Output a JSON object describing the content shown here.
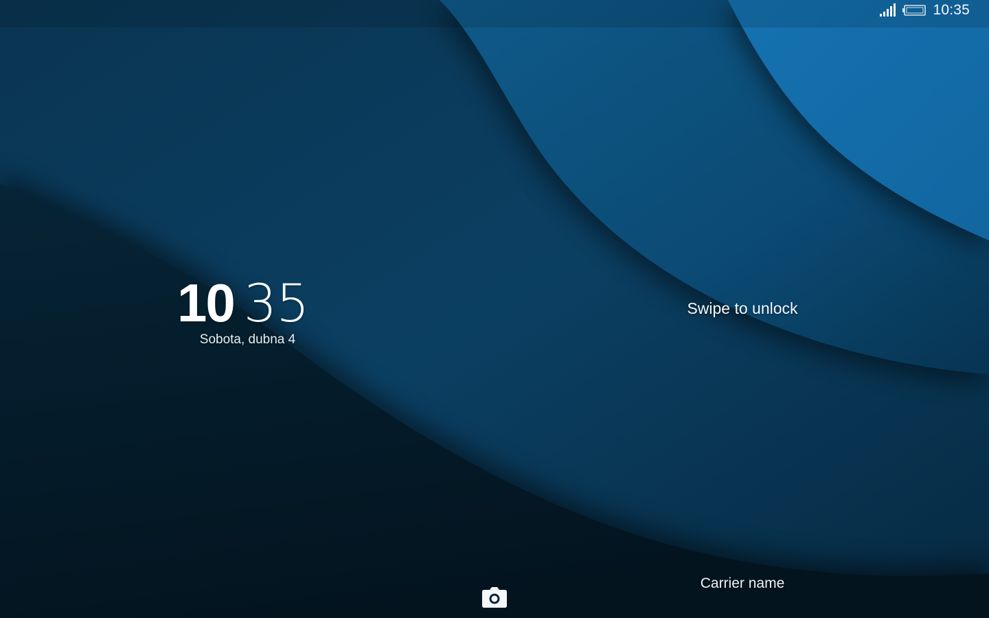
{
  "status_bar": {
    "time": "10:35",
    "signal_icon": "cellular-signal-icon",
    "battery_icon": "battery-icon"
  },
  "lockscreen": {
    "clock_hours": "10",
    "clock_minutes": "35",
    "date": "Sobota, dubna 4",
    "swipe_hint": "Swipe to unlock",
    "carrier": "Carrier name",
    "camera_icon": "camera-icon"
  },
  "colors": {
    "wave_dark": "#041a29",
    "wave_mid": "#0b3a5a",
    "wave_light": "#136ea7",
    "text": "#ffffff"
  }
}
